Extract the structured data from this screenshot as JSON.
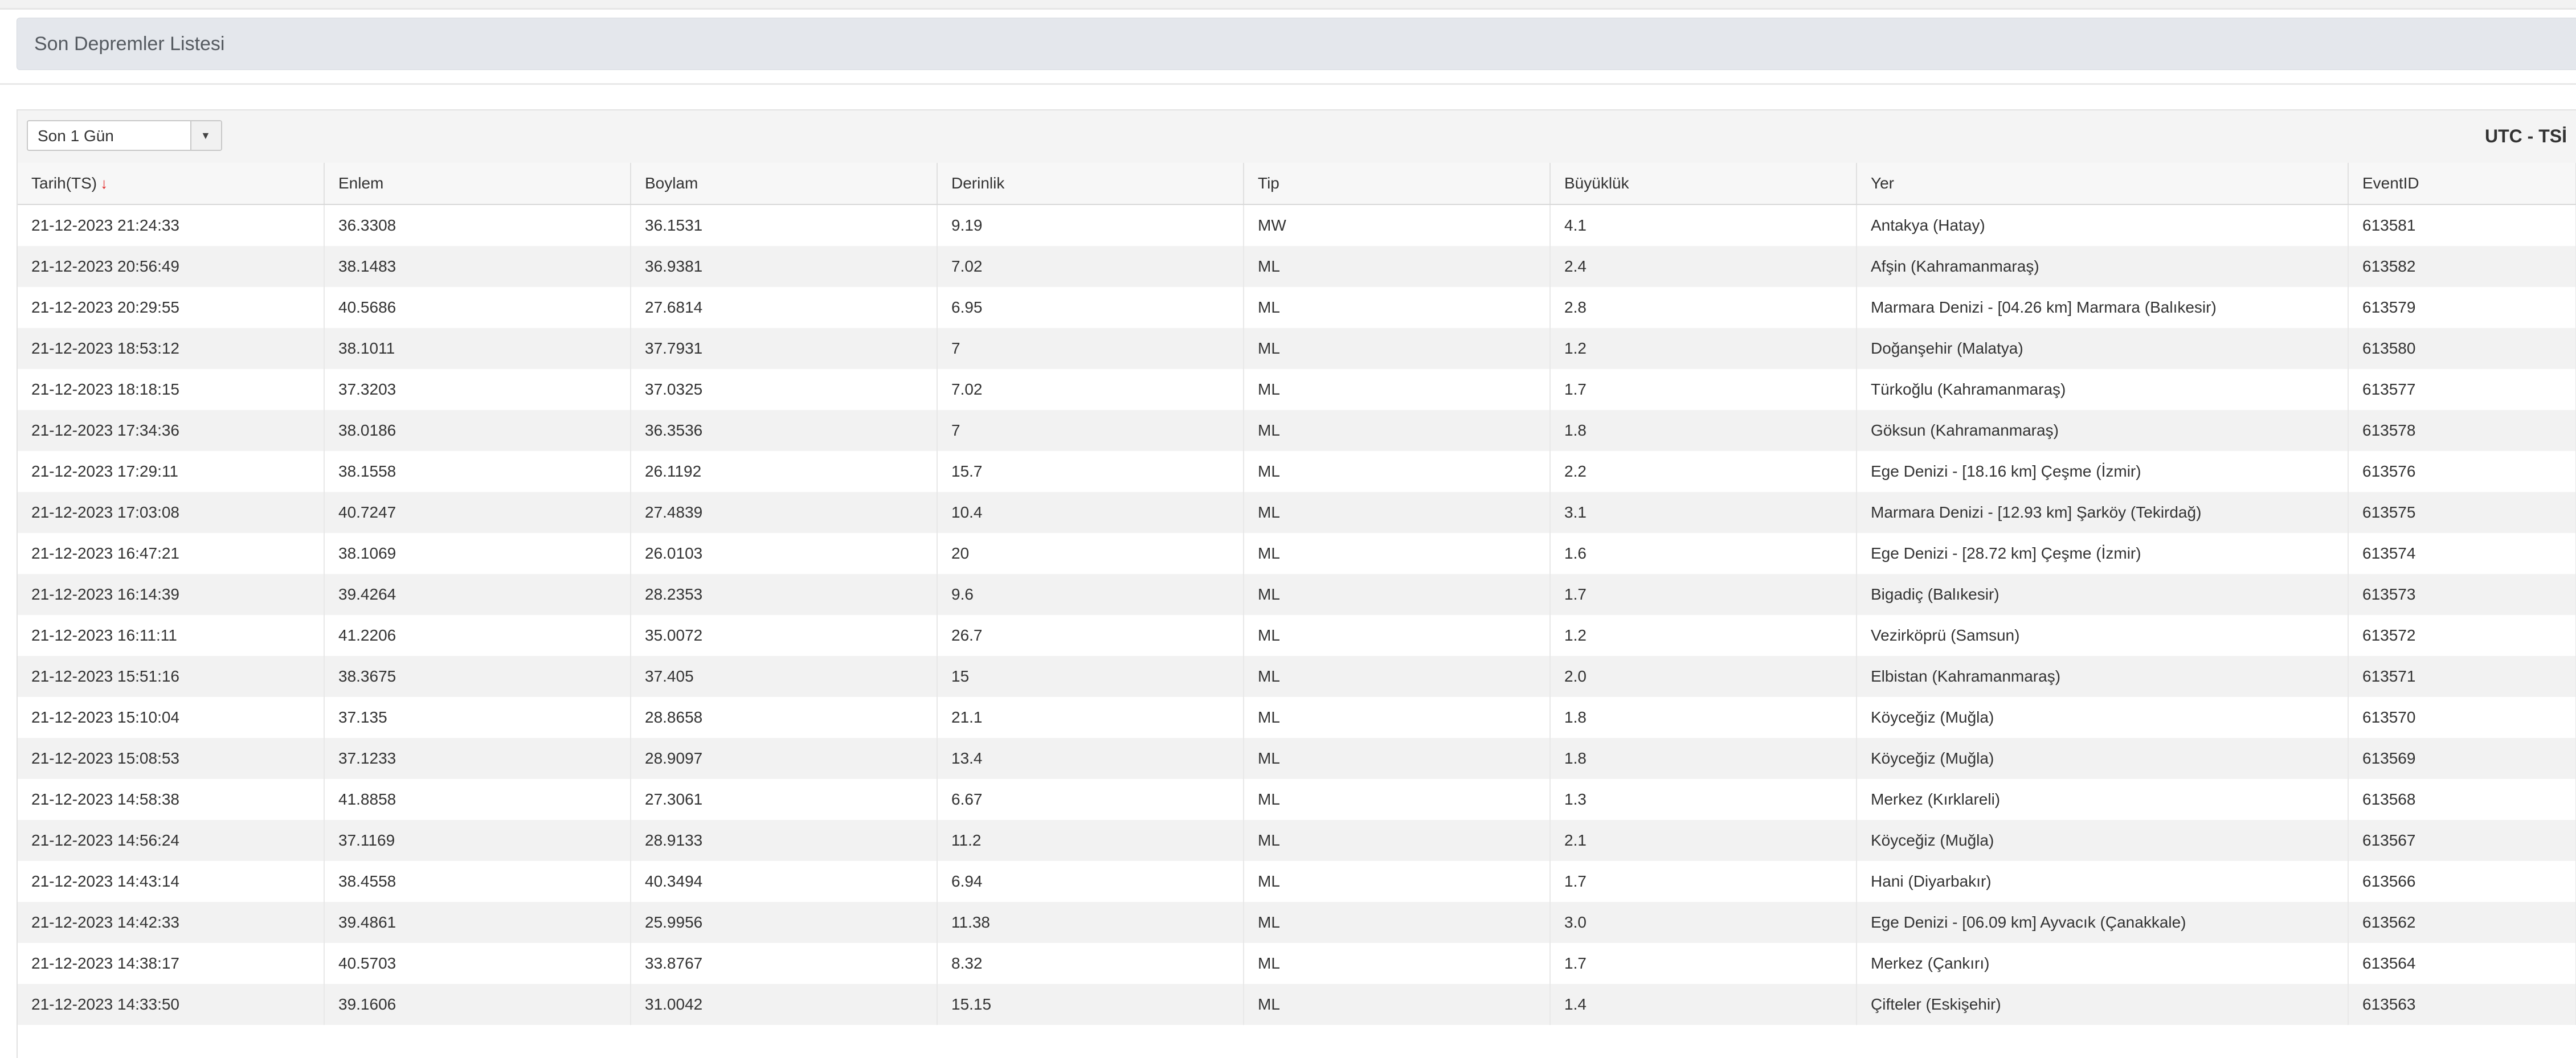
{
  "header": {
    "title": "Son Depremler Listesi"
  },
  "filter": {
    "selected": "Son 1 Gün",
    "dropdown_icon": "chevron-down-icon"
  },
  "timezone_label": "UTC - TSİ",
  "table": {
    "columns": [
      "Tarih(TS)",
      "Enlem",
      "Boylam",
      "Derinlik",
      "Tip",
      "Büyüklük",
      "Yer",
      "EventID"
    ],
    "sort_icon": "↓",
    "sort_color": "#e02020",
    "rows": [
      [
        "21-12-2023 21:24:33",
        "36.3308",
        "36.1531",
        "9.19",
        "MW",
        "4.1",
        "Antakya (Hatay)",
        "613581"
      ],
      [
        "21-12-2023 20:56:49",
        "38.1483",
        "36.9381",
        "7.02",
        "ML",
        "2.4",
        "Afşin (Kahramanmaraş)",
        "613582"
      ],
      [
        "21-12-2023 20:29:55",
        "40.5686",
        "27.6814",
        "6.95",
        "ML",
        "2.8",
        "Marmara Denizi - [04.26 km] Marmara (Balıkesir)",
        "613579"
      ],
      [
        "21-12-2023 18:53:12",
        "38.1011",
        "37.7931",
        "7",
        "ML",
        "1.2",
        "Doğanşehir (Malatya)",
        "613580"
      ],
      [
        "21-12-2023 18:18:15",
        "37.3203",
        "37.0325",
        "7.02",
        "ML",
        "1.7",
        "Türkoğlu (Kahramanmaraş)",
        "613577"
      ],
      [
        "21-12-2023 17:34:36",
        "38.0186",
        "36.3536",
        "7",
        "ML",
        "1.8",
        "Göksun (Kahramanmaraş)",
        "613578"
      ],
      [
        "21-12-2023 17:29:11",
        "38.1558",
        "26.1192",
        "15.7",
        "ML",
        "2.2",
        "Ege Denizi - [18.16 km] Çeşme (İzmir)",
        "613576"
      ],
      [
        "21-12-2023 17:03:08",
        "40.7247",
        "27.4839",
        "10.4",
        "ML",
        "3.1",
        "Marmara Denizi - [12.93 km] Şarköy (Tekirdağ)",
        "613575"
      ],
      [
        "21-12-2023 16:47:21",
        "38.1069",
        "26.0103",
        "20",
        "ML",
        "1.6",
        "Ege Denizi - [28.72 km] Çeşme (İzmir)",
        "613574"
      ],
      [
        "21-12-2023 16:14:39",
        "39.4264",
        "28.2353",
        "9.6",
        "ML",
        "1.7",
        "Bigadiç (Balıkesir)",
        "613573"
      ],
      [
        "21-12-2023 16:11:11",
        "41.2206",
        "35.0072",
        "26.7",
        "ML",
        "1.2",
        "Vezirköprü (Samsun)",
        "613572"
      ],
      [
        "21-12-2023 15:51:16",
        "38.3675",
        "37.405",
        "15",
        "ML",
        "2.0",
        "Elbistan (Kahramanmaraş)",
        "613571"
      ],
      [
        "21-12-2023 15:10:04",
        "37.135",
        "28.8658",
        "21.1",
        "ML",
        "1.8",
        "Köyceğiz (Muğla)",
        "613570"
      ],
      [
        "21-12-2023 15:08:53",
        "37.1233",
        "28.9097",
        "13.4",
        "ML",
        "1.8",
        "Köyceğiz (Muğla)",
        "613569"
      ],
      [
        "21-12-2023 14:58:38",
        "41.8858",
        "27.3061",
        "6.67",
        "ML",
        "1.3",
        "Merkez (Kırklareli)",
        "613568"
      ],
      [
        "21-12-2023 14:56:24",
        "37.1169",
        "28.9133",
        "11.2",
        "ML",
        "2.1",
        "Köyceğiz (Muğla)",
        "613567"
      ],
      [
        "21-12-2023 14:43:14",
        "38.4558",
        "40.3494",
        "6.94",
        "ML",
        "1.7",
        "Hani (Diyarbakır)",
        "613566"
      ],
      [
        "21-12-2023 14:42:33",
        "39.4861",
        "25.9956",
        "11.38",
        "ML",
        "3.0",
        "Ege Denizi - [06.09 km] Ayvacık (Çanakkale)",
        "613562"
      ],
      [
        "21-12-2023 14:38:17",
        "40.5703",
        "33.8767",
        "8.32",
        "ML",
        "1.7",
        "Merkez (Çankırı)",
        "613564"
      ],
      [
        "21-12-2023 14:33:50",
        "39.1606",
        "31.0042",
        "15.15",
        "ML",
        "1.4",
        "Çifteler (Eskişehir)",
        "613563"
      ]
    ]
  }
}
